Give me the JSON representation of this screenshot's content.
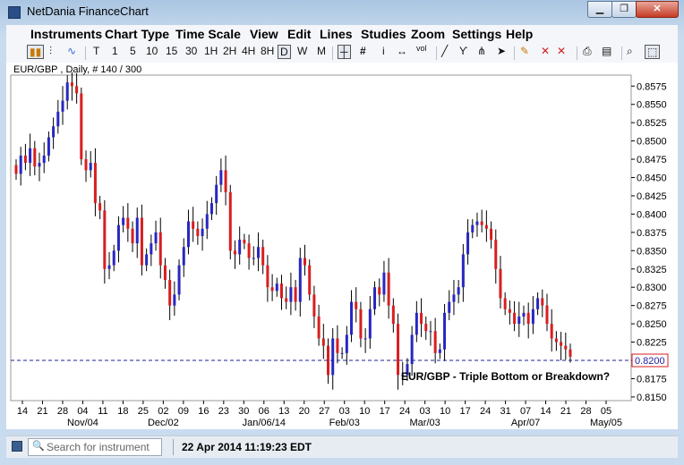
{
  "window": {
    "title": "NetDania FinanceChart",
    "min_glyph": "▁",
    "max_glyph": "❐",
    "close_glyph": "✕"
  },
  "menu": [
    "Instruments",
    "Chart Type",
    "Time Scale",
    "View",
    "Edit",
    "Lines",
    "Studies",
    "Zoom",
    "Settings",
    "Help"
  ],
  "toolbar": {
    "timescales": [
      "T",
      "1",
      "5",
      "10",
      "15",
      "30",
      "1H",
      "2H",
      "4H",
      "8H",
      "D",
      "W",
      "M"
    ],
    "selected_timescale": "D",
    "icons": [
      "candlestick-icon",
      "ohlc-bars-icon",
      "line-chart-icon",
      "crosshair-icon",
      "grid-icon",
      "info-icon",
      "scroll-icon",
      "volume-icon",
      "trendline-icon",
      "fibonacci-icon",
      "pitchfork-icon",
      "cursor-icon",
      "pencil-icon",
      "delete-all-icon",
      "print-icon",
      "print-preview-icon",
      "zoom-icon",
      "select-icon"
    ],
    "vol_label": "vol"
  },
  "chart": {
    "header": "EUR/GBP , Daily, # 140 / 300",
    "annotation": "EUR/GBP - Triple Bottom or Breakdown?",
    "current_price": "0.8200",
    "colors": {
      "up": "#2727c2",
      "down": "#d81e1e",
      "hline": "#1f1f9b",
      "grid": "#c8c8c8"
    }
  },
  "chart_data": {
    "type": "candlestick",
    "title": "",
    "ylim": [
      0.8145,
      0.859
    ],
    "yticks": [
      "0.8575",
      "0.8550",
      "0.8525",
      "0.8500",
      "0.8475",
      "0.8450",
      "0.8425",
      "0.8400",
      "0.8375",
      "0.8350",
      "0.8325",
      "0.8300",
      "0.8275",
      "0.8250",
      "0.8225",
      "0.8200",
      "0.8175",
      "0.8150"
    ],
    "xticks_day": [
      "14",
      "21",
      "28",
      "04",
      "11",
      "18",
      "25",
      "02",
      "09",
      "16",
      "23",
      "30",
      "06",
      "13",
      "20",
      "27",
      "03",
      "10",
      "17",
      "24",
      "03",
      "10",
      "17",
      "24",
      "31",
      "07",
      "14",
      "21",
      "28",
      "05"
    ],
    "xticks_month": [
      "Nov/04",
      "Dec/02",
      "Jan/06/14",
      "Feb/03",
      "Mar/03",
      "Apr/07",
      "May/05"
    ],
    "horizontal_line": 0.82,
    "closes": [
      0.8455,
      0.848,
      0.847,
      0.849,
      0.8465,
      0.847,
      0.848,
      0.8505,
      0.852,
      0.854,
      0.8555,
      0.858,
      0.8575,
      0.8565,
      0.8475,
      0.846,
      0.847,
      0.8415,
      0.8405,
      0.8325,
      0.833,
      0.835,
      0.8385,
      0.8395,
      0.838,
      0.836,
      0.8395,
      0.833,
      0.8345,
      0.836,
      0.8375,
      0.833,
      0.831,
      0.8275,
      0.829,
      0.833,
      0.8355,
      0.839,
      0.838,
      0.837,
      0.838,
      0.84,
      0.8415,
      0.844,
      0.846,
      0.843,
      0.835,
      0.8345,
      0.8365,
      0.836,
      0.834,
      0.834,
      0.8355,
      0.833,
      0.83,
      0.8295,
      0.8305,
      0.8285,
      0.828,
      0.83,
      0.828,
      0.834,
      0.833,
      0.829,
      0.826,
      0.823,
      0.822,
      0.818,
      0.823,
      0.821,
      0.821,
      0.8235,
      0.828,
      0.827,
      0.823,
      0.823,
      0.827,
      0.83,
      0.829,
      0.832,
      0.8275,
      0.825,
      0.818,
      0.818,
      0.8195,
      0.8235,
      0.8265,
      0.825,
      0.824,
      0.824,
      0.821,
      0.8215,
      0.8265,
      0.828,
      0.829,
      0.83,
      0.8345,
      0.8375,
      0.8385,
      0.839,
      0.8385,
      0.838,
      0.8365,
      0.8325,
      0.8285,
      0.827,
      0.8265,
      0.825,
      0.826,
      0.8265,
      0.825,
      0.827,
      0.8285,
      0.8275,
      0.825,
      0.823,
      0.8225,
      0.822,
      0.8215,
      0.8205
    ]
  },
  "status": {
    "search_placeholder": "Search for instrument",
    "timestamp": "22 Apr 2014 11:19:23 EDT"
  }
}
